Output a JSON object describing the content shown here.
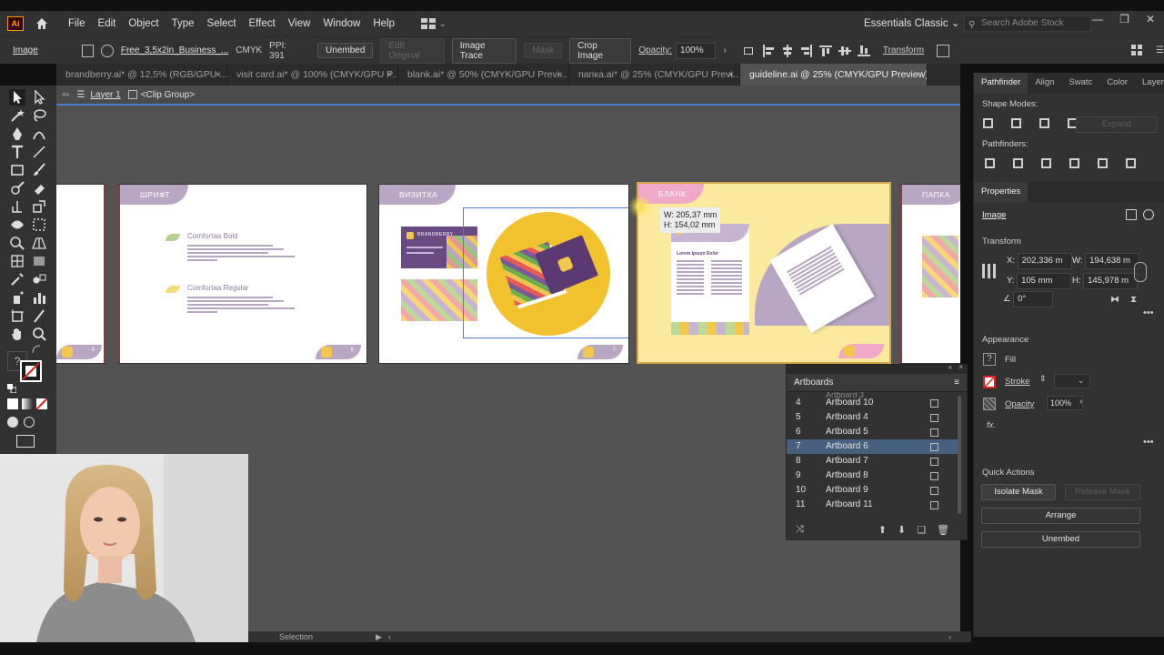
{
  "app": {
    "logo": "Ai",
    "workspace": "Essentials Classic",
    "search_placeholder": "Search Adobe Stock"
  },
  "menu": [
    "File",
    "Edit",
    "Object",
    "Type",
    "Select",
    "Effect",
    "View",
    "Window",
    "Help"
  ],
  "control_bar": {
    "mode": "Image",
    "file": "Free_3,5x2in_Business_...",
    "color_mode": "CMYK",
    "ppi": "PPI: 391",
    "unembed": "Unembed",
    "edit_original": "Edit Original",
    "image_trace": "Image Trace",
    "mask": "Mask",
    "crop_image": "Crop Image",
    "opacity_label": "Opacity:",
    "opacity_value": "100%",
    "transform": "Transform"
  },
  "tabs": [
    "brandberry.ai* @ 12,5% (RGB/GPU ...",
    "visit card.ai* @ 100% (CMYK/GPU P...",
    "blank.ai* @ 50% (CMYK/GPU Previ...",
    "папка.ai* @ 25% (CMYK/GPU Previ...",
    "guideline.ai @ 25% (CMYK/GPU Preview)"
  ],
  "breadcrumb": {
    "layer": "Layer 1",
    "group": "<Clip Group>"
  },
  "artboards_canvas": {
    "font_label": "ШРИФТ",
    "card_label": "ВИЗИТКА",
    "blank_label": "БЛАНК",
    "folder_label": "ПАПКА",
    "font_bold": "Comfortaa Bold",
    "font_regular": "Comfortaa Regular",
    "brand": "BRANDBERRY",
    "lorem_title": "Lorem Ipsum Dolor",
    "page_num_left": "5",
    "page_num_font": "6",
    "page_num_card": "7"
  },
  "measure": {
    "w": "W: 205,37 mm",
    "h": "H: 154,02 mm"
  },
  "artboards_panel": {
    "title": "Artboards",
    "partial_row": "Artboard 3",
    "rows": [
      {
        "num": "4",
        "name": "Artboard 10"
      },
      {
        "num": "5",
        "name": "Artboard 4"
      },
      {
        "num": "6",
        "name": "Artboard 5"
      },
      {
        "num": "7",
        "name": "Artboard 6"
      },
      {
        "num": "8",
        "name": "Artboard 7"
      },
      {
        "num": "9",
        "name": "Artboard 8"
      },
      {
        "num": "10",
        "name": "Artboard 9"
      },
      {
        "num": "11",
        "name": "Artboard 11"
      }
    ],
    "selected_index": 3
  },
  "right_panel": {
    "tabs": [
      "Pathfinder",
      "Align",
      "Swatc",
      "Color",
      "Layers"
    ],
    "shape_modes": "Shape Modes:",
    "expand": "Expand",
    "pathfinders": "Pathfinders:",
    "properties": "Properties",
    "image": "Image",
    "transform": "Transform",
    "x_label": "X:",
    "x_value": "202,336 m",
    "y_label": "Y:",
    "y_value": "105 mm",
    "w_label": "W:",
    "w_value": "194,638 m",
    "h_label": "H:",
    "h_value": "145,978 m",
    "angle_value": "0°",
    "appearance": "Appearance",
    "fill": "Fill",
    "stroke": "Stroke",
    "opacity": "Opacity",
    "opacity_value": "100%",
    "fx": "fx.",
    "quick_actions": "Quick Actions",
    "isolate_mask": "Isolate Mask",
    "release_mask": "Release Mask",
    "arrange": "Arrange",
    "unembed": "Unembed"
  },
  "status": {
    "tool": "Selection"
  },
  "colors": {
    "lavender": "#b9a6c4",
    "purple": "#5f3f73",
    "yellow": "#f2c12e",
    "pale_yellow": "#fbe99e",
    "selection_blue": "#4d7bd1"
  }
}
